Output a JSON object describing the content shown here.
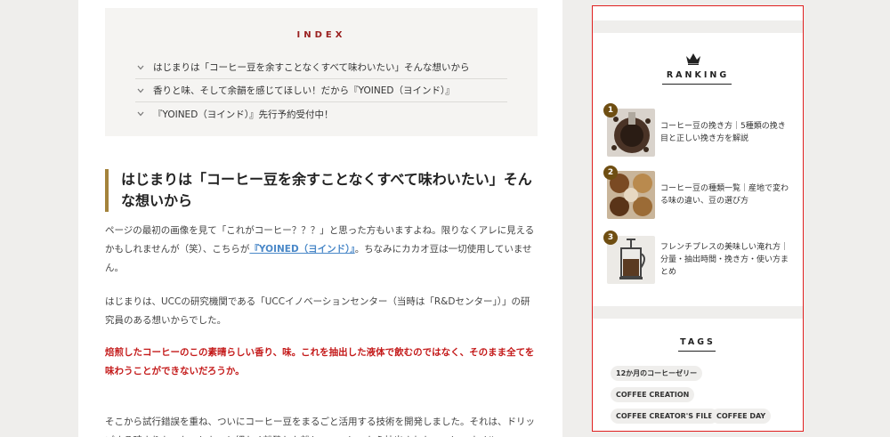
{
  "toc": {
    "title": "INDEX",
    "items": [
      "はじまりは「コーヒー豆を余すことなくすべて味わいたい」そんな想いから",
      "香りと味、そして余韻を感じてほしい！だから『YOINED（ヨインド）』",
      "『YOINED（ヨインド）』先行予約受付中！"
    ]
  },
  "article": {
    "heading": "はじまりは「コーヒー豆を余すことなくすべて味わいたい」そんな想いから",
    "p1_before": "ページの最初の画像を見て「これがコーヒー？？？」と思った方もいますよね。限りなくアレに見えるかもしれませんが（笑）、こちらが",
    "p1_link": "『YOINED（ヨインド）』",
    "p1_after": "。ちなみにカカオ豆は一切使用していません。",
    "p2": "はじまりは、UCCの研究機関である「UCCイノベーションセンター（当時は「R&Dセンター」）」の研究員のある想いからでした。",
    "p3": "焙煎したコーヒーのこの素晴らしい香り、味。これを抽出した液体で飲むのではなく、そのまま全てを味わうことができないだろうか。",
    "p4": "そこから試行錯誤を重ね、ついにコーヒー豆をまるごと活用する技術を開発しました。それは、ドリップする時よりも、もっともっと細かく粉砕した粉と、コーヒーから抽出されたコーヒーオイル、"
  },
  "sidebar": {
    "ranking_title": "RANKING",
    "ranking": [
      {
        "rank": "1",
        "title": "コーヒー豆の挽き方｜5種類の挽き目と正しい挽き方を解説"
      },
      {
        "rank": "2",
        "title": "コーヒー豆の種類一覧｜産地で変わる味の違い、豆の選び方"
      },
      {
        "rank": "3",
        "title": "フレンチプレスの美味しい淹れ方｜分量・抽出時間・挽き方・使い方まとめ"
      }
    ],
    "tags_title": "TAGS",
    "tags": [
      "12か月のコーヒーゼリー",
      "COFFEE CREATION",
      "COFFEE CREATOR'S FILE",
      "COFFEE DAY"
    ]
  },
  "colors": {
    "accent_gold": "#a4833b",
    "badge_brown": "#6f4e12",
    "highlight_red": "#c41a1a",
    "link_blue": "#4a88c8",
    "sidebar_border": "#e02020"
  }
}
